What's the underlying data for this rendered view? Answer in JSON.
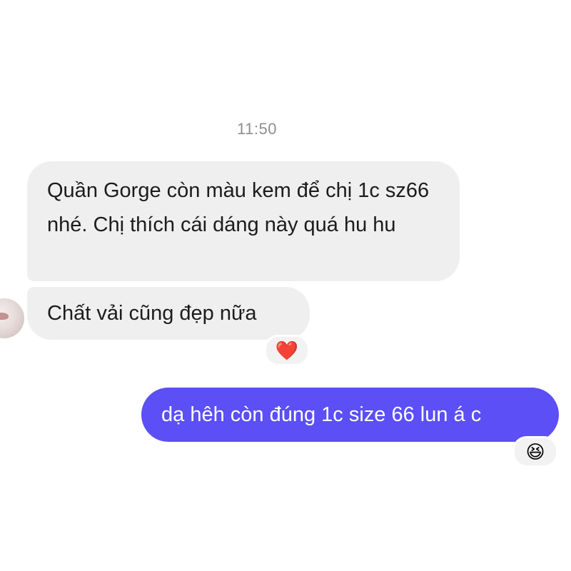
{
  "chat": {
    "timestamp": "11:50",
    "messages": [
      {
        "direction": "incoming",
        "text": "Quần Gorge còn màu kem để chị 1c sz66 nhé. Chị thích cái dáng này quá hu hu"
      },
      {
        "direction": "incoming",
        "text": "Chất vải cũng đẹp nữa",
        "reaction": "❤️"
      },
      {
        "direction": "outgoing",
        "text": "dạ hêh còn đúng 1c size 66 lun á c",
        "reaction": "😆"
      }
    ],
    "colors": {
      "outgoing_bubble": "#5b4ff5",
      "incoming_bubble": "#efefef",
      "timestamp": "#8e8e93"
    },
    "icons": {
      "contact_avatar": "contact-avatar",
      "heart_reaction": "heart-reaction-icon",
      "laugh_reaction": "laughing-face-reaction-icon"
    }
  }
}
